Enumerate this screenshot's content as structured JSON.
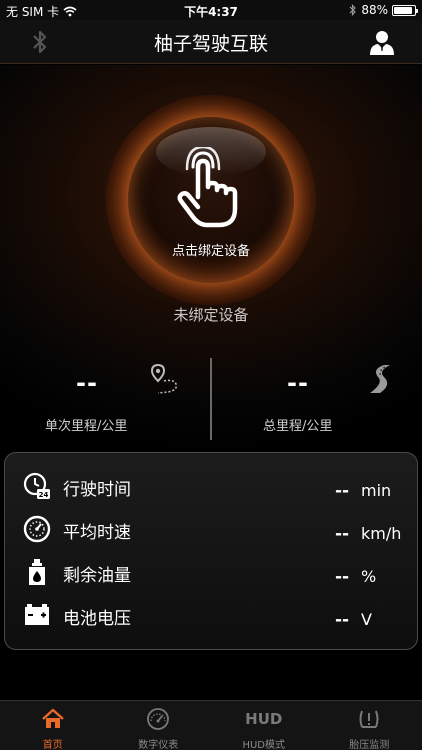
{
  "status_bar": {
    "carrier": "无 SIM 卡",
    "time": "下午4:37",
    "battery": "88%",
    "battery_level": 0.88
  },
  "nav": {
    "title": "柚子驾驶互联",
    "left_icon": "bluetooth-icon",
    "right_icon": "user-icon"
  },
  "device": {
    "button_label": "点击绑定设备",
    "status": "未绑定设备"
  },
  "mileage": {
    "trip": {
      "value": "--",
      "label": "单次里程/公里"
    },
    "total": {
      "value": "--",
      "label": "总里程/公里"
    }
  },
  "metrics": [
    {
      "name": "行驶时间",
      "value": "--",
      "unit": "min",
      "icon": "clock-24h-icon"
    },
    {
      "name": "平均时速",
      "value": "--",
      "unit": "km/h",
      "icon": "speedometer-icon"
    },
    {
      "name": "剩余油量",
      "value": "--",
      "unit": "%",
      "icon": "fuel-can-icon"
    },
    {
      "name": "电池电压",
      "value": "--",
      "unit": "V",
      "icon": "battery-voltage-icon"
    }
  ],
  "tabs": [
    {
      "label": "首页",
      "active": true
    },
    {
      "label": "数字仪表",
      "active": false
    },
    {
      "label": "HUD模式",
      "icon_text": "HUD",
      "active": false
    },
    {
      "label": "胎压监测",
      "active": false
    }
  ],
  "colors": {
    "accent": "#e8692a",
    "glow": "#ff7a2a"
  }
}
